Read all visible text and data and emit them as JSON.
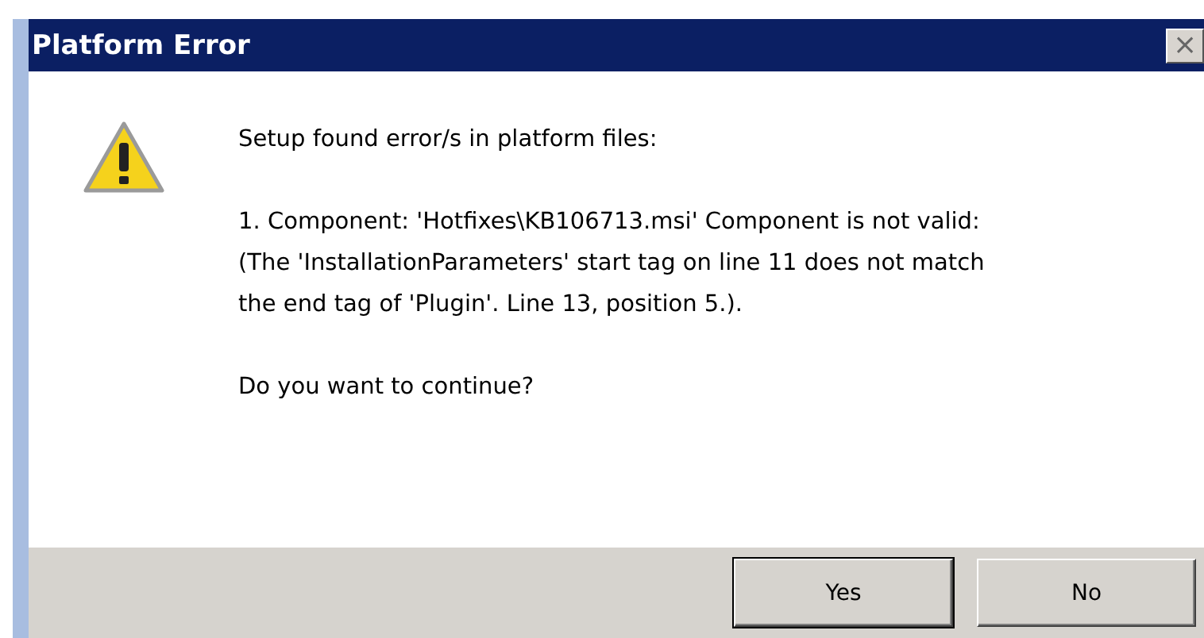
{
  "window": {
    "title": "Platform Error",
    "close": "×"
  },
  "message": {
    "paragraphs": [
      "Setup found error/s in platform files:",
      "1. Component: 'Hotfixes\\KB106713.msi' Component is not valid:\n(The 'InstallationParameters' start tag on line 11 does not match\nthe end tag of 'Plugin'. Line 13, position 5.).",
      "Do you want to continue?"
    ]
  },
  "buttons": [
    {
      "label": "Yes",
      "default": true
    },
    {
      "label": "No",
      "default": false
    }
  ]
}
